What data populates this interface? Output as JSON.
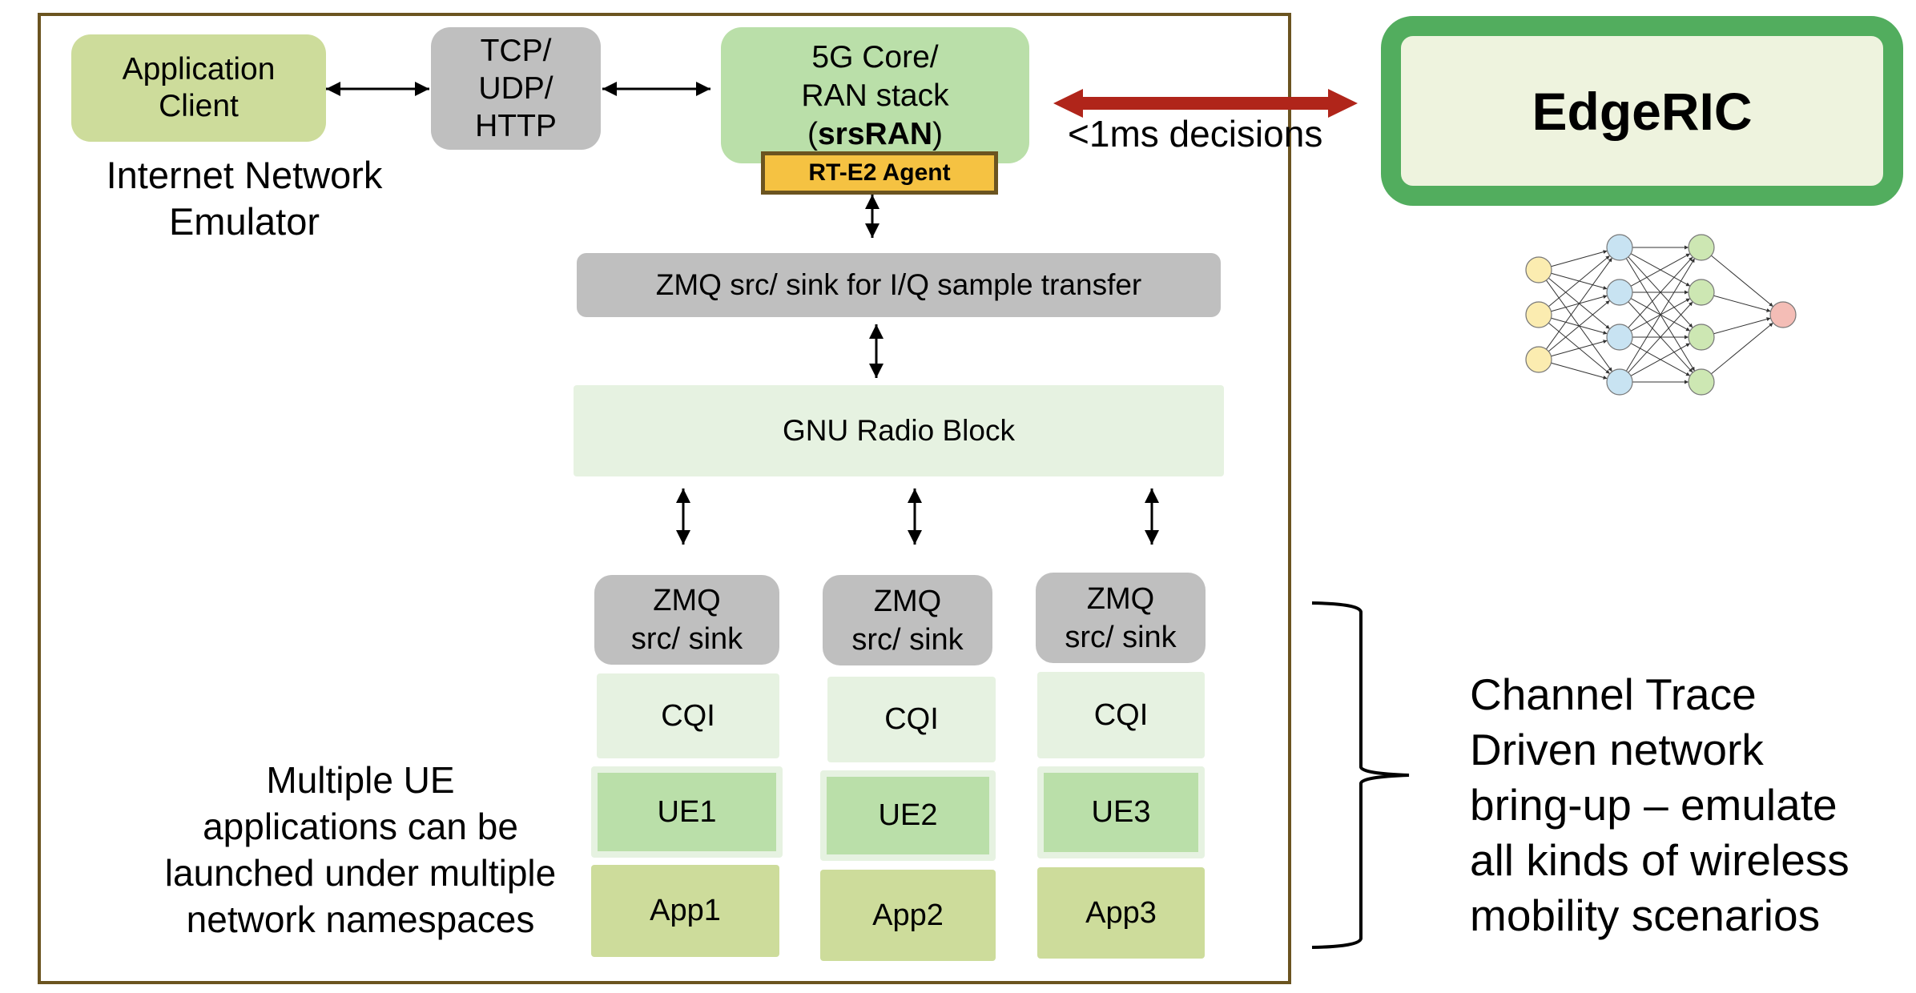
{
  "emulator_frame": {
    "title_line1": "Internet Network",
    "title_line2": "Emulator",
    "application_client": {
      "line1": "Application",
      "line2": "Client"
    },
    "transport": {
      "line1": "TCP/",
      "line2": "UDP/",
      "line3": "HTTP"
    },
    "core": {
      "line1": "5G Core/",
      "line2": "RAN stack",
      "line3_open": "(",
      "line3_bold": "srsRAN",
      "line3_close": ")"
    },
    "agent": "RT-E2 Agent",
    "zmq_bus": "ZMQ src/ sink for I/Q sample transfer",
    "gnu_radio": "GNU Radio Block",
    "ue_columns": [
      {
        "zmq_line1": "ZMQ",
        "zmq_line2": "src/ sink",
        "cqi": "CQI",
        "ue": "UE1",
        "app": "App1"
      },
      {
        "zmq_line1": "ZMQ",
        "zmq_line2": "src/ sink",
        "cqi": "CQI",
        "ue": "UE2",
        "app": "App2"
      },
      {
        "zmq_line1": "ZMQ",
        "zmq_line2": "src/ sink",
        "cqi": "CQI",
        "ue": "UE3",
        "app": "App3"
      }
    ],
    "multi_ue_note": [
      "Multiple UE",
      "applications can be",
      "launched under multiple",
      "network namespaces"
    ]
  },
  "link_label": "<1ms decisions",
  "edgeric": {
    "title": "EdgeRIC"
  },
  "neural_net": {
    "layers": [
      3,
      4,
      4,
      1
    ],
    "layer_colors": [
      "#fbecb0",
      "#c8e3f2",
      "#cde7b3",
      "#f4bdb6"
    ]
  },
  "channel_note": [
    "Channel Trace",
    "Driven network",
    "bring-up – emulate",
    "all kinds of wireless",
    "mobility scenarios"
  ],
  "colors": {
    "frame": "#6b5420",
    "edgeric_border": "#52ad5e",
    "decision_arrow": "#b0251a",
    "agent_fill": "#f5c242"
  }
}
